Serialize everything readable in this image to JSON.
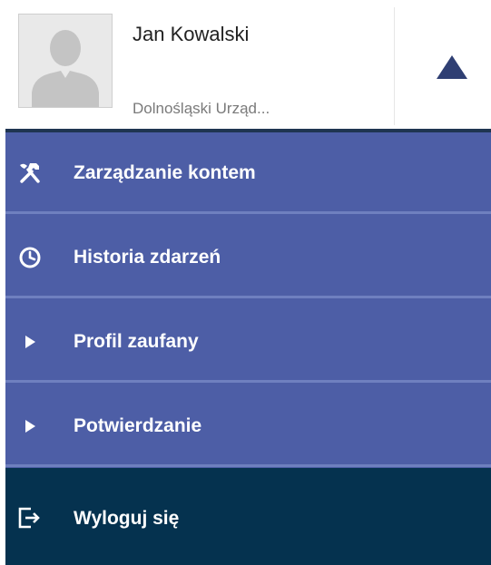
{
  "user": {
    "name": "Jan Kowalski",
    "organization": "Dolnośląski Urząd..."
  },
  "header": {
    "toggle_icon": "caret-up-icon"
  },
  "menu": {
    "items": [
      {
        "label": "Zarządzanie kontem",
        "icon": "tools-icon"
      },
      {
        "label": "Historia zdarzeń",
        "icon": "clock-icon"
      },
      {
        "label": "Profil zaufany",
        "icon": "play-arrow-icon"
      },
      {
        "label": "Potwierdzanie",
        "icon": "play-arrow-icon"
      }
    ],
    "logout": {
      "label": "Wyloguj się",
      "icon": "logout-icon"
    }
  },
  "colors": {
    "menu_background": "#4d5ea6",
    "menu_separator": "#6f80bf",
    "logout_background": "#05324f",
    "caret": "#2f3f73"
  }
}
